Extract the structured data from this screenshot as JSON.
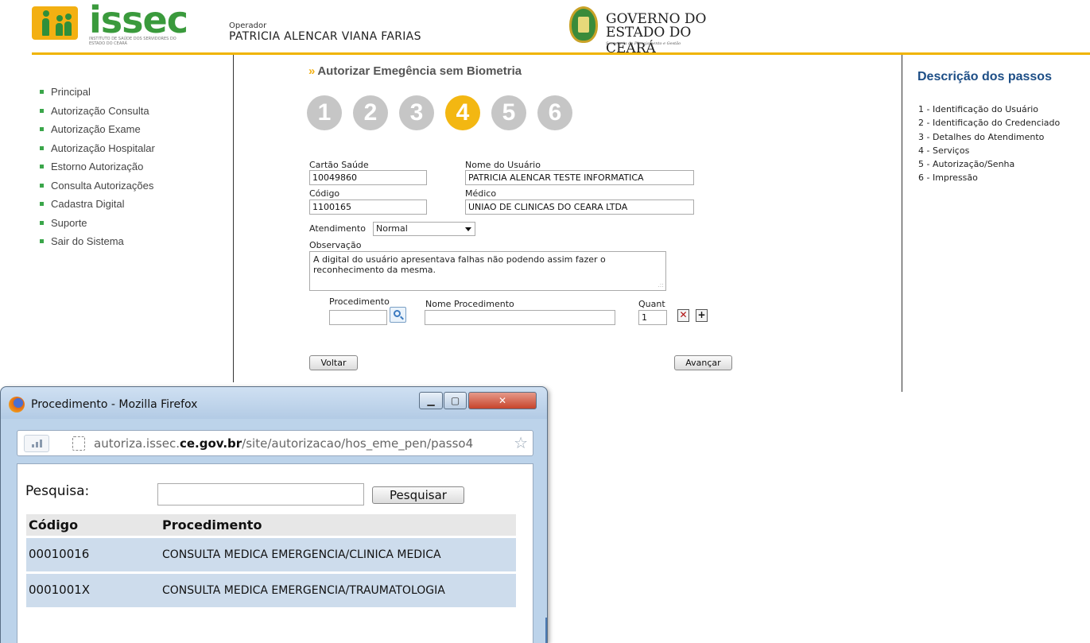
{
  "header": {
    "logo_text": "issec",
    "logo_subtitle": "INSTITUTO DE SAÚDE DOS SERVIDORES DO ESTADO DO CEARÁ",
    "operator_label": "Operador",
    "operator_name": "PATRICIA ALENCAR VIANA FARIAS",
    "gov_line1": "GOVERNO DO",
    "gov_line2": "ESTADO DO CEARÁ",
    "gov_line3": "Secretaria do Planejamento e Gestão",
    "accent_color": "#f0b400"
  },
  "nav": {
    "items": [
      {
        "label": "Principal"
      },
      {
        "label": "Autorização Consulta"
      },
      {
        "label": "Autorização Exame"
      },
      {
        "label": "Autorização Hospitalar"
      },
      {
        "label": "Estorno Autorização"
      },
      {
        "label": "Consulta Autorizações"
      },
      {
        "label": "Cadastra Digital"
      },
      {
        "label": "Suporte"
      },
      {
        "label": "Sair do Sistema"
      }
    ]
  },
  "main": {
    "title_arrows": "»",
    "title": "Autorizar Emegência sem Biometria",
    "steps": [
      "1",
      "2",
      "3",
      "4",
      "5",
      "6"
    ],
    "active_step": 4,
    "cartao_label": "Cartão Saúde",
    "cartao_value": "10049860",
    "nome_usuario_label": "Nome do Usuário",
    "nome_usuario_value": "PATRICIA ALENCAR TESTE INFORMATICA",
    "codigo_label": "Código",
    "codigo_value": "1100165",
    "medico_label": "Médico",
    "medico_value": "UNIAO DE CLINICAS DO CEARA LTDA",
    "atendimento_label": "Atendimento",
    "atendimento_value": "Normal",
    "observacao_label": "Observação",
    "observacao_value": "A digital do usuário apresentava falhas não podendo assim fazer o reconhecimento da mesma.",
    "procedimento_label": "Procedimento",
    "nome_procedimento_label": "Nome Procedimento",
    "quant_label": "Quant",
    "quant_value": "1",
    "voltar_label": "Voltar",
    "avancar_label": "Avançar"
  },
  "steps_panel": {
    "title": "Descrição dos passos",
    "items": [
      "1 - Identificação do Usuário",
      "2 - Identificação do Credenciado",
      "3 - Detalhes do Atendimento",
      "4 - Serviços",
      "5 - Autorização/Senha",
      "6 - Impressão"
    ]
  },
  "popup": {
    "window_title": "Procedimento - Mozilla Firefox",
    "url_prefix": "autoriza.issec.",
    "url_domain": "ce.gov.br",
    "url_path": "/site/autorizacao/hos_eme_pen/passo4",
    "search_label": "Pesquisa:",
    "search_value": "",
    "search_button": "Pesquisar",
    "table": {
      "columns": [
        "Código",
        "Procedimento"
      ],
      "rows": [
        {
          "code": "00010016",
          "name": "CONSULTA MEDICA EMERGENCIA/CLINICA MEDICA"
        },
        {
          "code": "0001001X",
          "name": "CONSULTA MEDICA EMERGENCIA/TRAUMATOLOGIA"
        }
      ]
    }
  }
}
